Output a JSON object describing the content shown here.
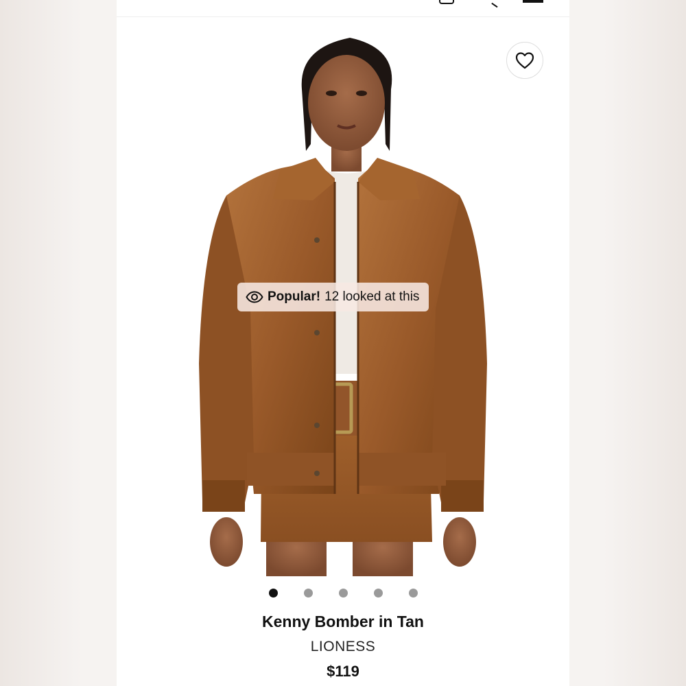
{
  "product": {
    "badge": {
      "icon": "eye-icon",
      "strong": "Popular!",
      "text": "12 looked at this"
    },
    "wishlist_icon": "heart-icon",
    "image_description": "model-in-tan-leather-bomber-jacket",
    "carousel": {
      "total": 5,
      "active_index": 0
    },
    "title": "Kenny Bomber in Tan",
    "brand": "LIONESS",
    "price": "$119"
  },
  "colors": {
    "leather": "#9a5a2a",
    "leather_dark": "#6e3c17",
    "leather_light": "#b7773f",
    "dot_active": "#111111",
    "dot_inactive": "#9a9a9a"
  }
}
